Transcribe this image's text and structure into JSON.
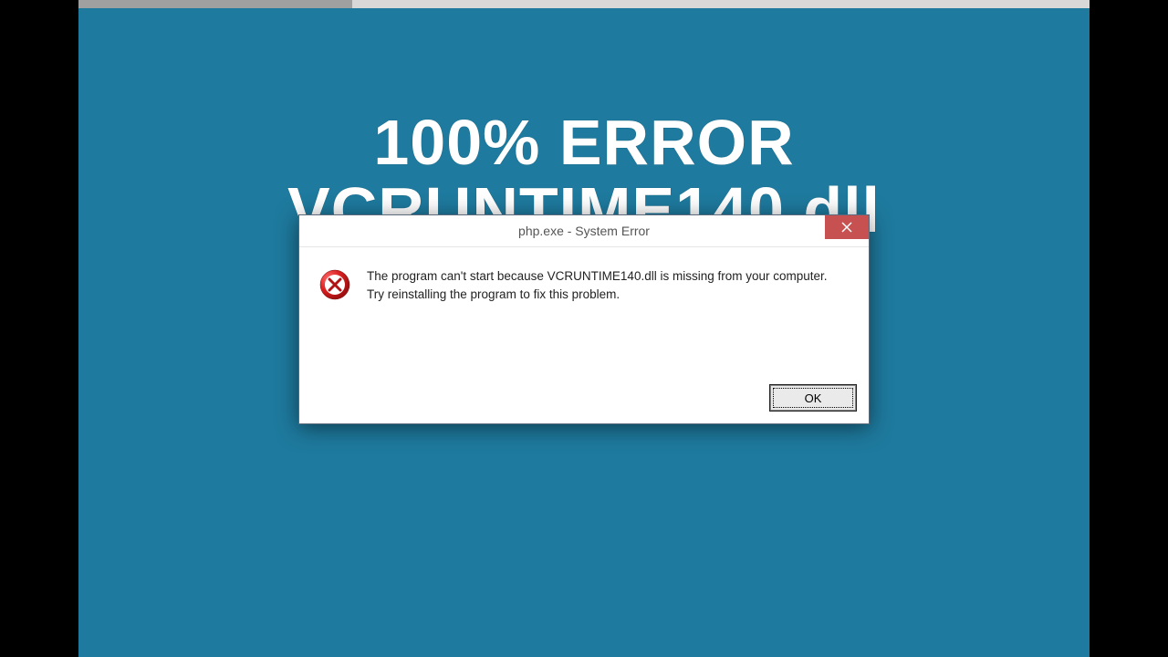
{
  "headline": "100% ERROR VCRUNTIME140.dll",
  "dialog": {
    "title": "php.exe - System Error",
    "message": "The program can't start because VCRUNTIME140.dll is missing from your computer. Try reinstalling the program to fix this problem.",
    "ok_label": "OK"
  },
  "colors": {
    "desktop": "#1e7a9e",
    "close_red": "#c75050"
  }
}
